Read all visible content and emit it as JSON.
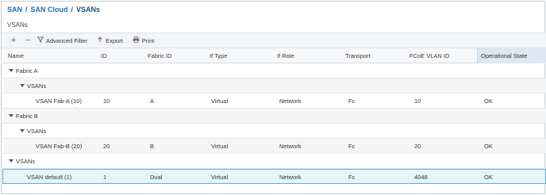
{
  "breadcrumb": {
    "items": [
      "SAN",
      "SAN Cloud",
      "VSANs"
    ],
    "separator": "/"
  },
  "section_title": "VSANs",
  "toolbar": {
    "add_symbol": "+",
    "remove_symbol": "−",
    "advanced_filter_label": "Advanced Filter",
    "export_label": "Export",
    "print_label": "Print"
  },
  "table": {
    "headers": {
      "name": "Name",
      "id": "ID",
      "fabric_id": "Fabric ID",
      "if_type": "If Type",
      "if_role": "If Role",
      "transport": "Transport",
      "fcoe_vlan_id": "FCoE VLAN ID",
      "operational_state": "Operational State"
    },
    "rows": [
      {
        "name": "Fabric A",
        "id": "",
        "fabric_id": "",
        "if_type": "",
        "if_role": "",
        "transport": "",
        "fcoe_vlan_id": "",
        "operational_state": ""
      },
      {
        "name": "VSANs",
        "id": "",
        "fabric_id": "",
        "if_type": "",
        "if_role": "",
        "transport": "",
        "fcoe_vlan_id": "",
        "operational_state": ""
      },
      {
        "name": "VSAN Fab-A (10)",
        "id": "10",
        "fabric_id": "A",
        "if_type": "Virtual",
        "if_role": "Network",
        "transport": "Fc",
        "fcoe_vlan_id": "10",
        "operational_state": "OK"
      },
      {
        "name": "Fabric B",
        "id": "",
        "fabric_id": "",
        "if_type": "",
        "if_role": "",
        "transport": "",
        "fcoe_vlan_id": "",
        "operational_state": ""
      },
      {
        "name": "VSANs",
        "id": "",
        "fabric_id": "",
        "if_type": "",
        "if_role": "",
        "transport": "",
        "fcoe_vlan_id": "",
        "operational_state": ""
      },
      {
        "name": "VSAN Fab-B (20)",
        "id": "20",
        "fabric_id": "B",
        "if_type": "Virtual",
        "if_role": "Network",
        "transport": "Fc",
        "fcoe_vlan_id": "20",
        "operational_state": "OK"
      },
      {
        "name": "VSANs",
        "id": "",
        "fabric_id": "",
        "if_type": "",
        "if_role": "",
        "transport": "",
        "fcoe_vlan_id": "",
        "operational_state": ""
      },
      {
        "name": "VSAN default (1)",
        "id": "1",
        "fabric_id": "Dual",
        "if_type": "Virtual",
        "if_role": "Network",
        "transport": "Fc",
        "fcoe_vlan_id": "4048",
        "operational_state": "OK"
      }
    ],
    "selected_row_index": 7
  },
  "colors": {
    "link": "#1f6fb2",
    "selected_row_bg": "#e6f4f8",
    "selected_row_border": "#5eaecb",
    "sorted_header_bg": "#dde7f2"
  }
}
